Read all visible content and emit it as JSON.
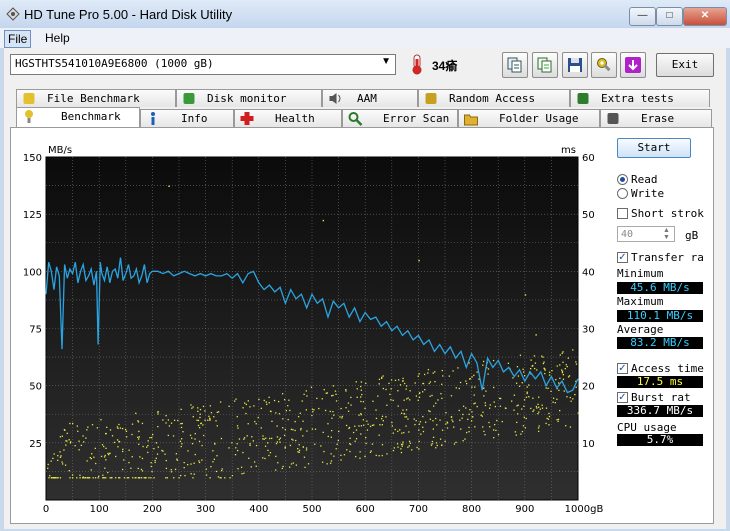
{
  "window": {
    "title": "HD Tune Pro 5.00 - Hard Disk Utility",
    "minimize": "—",
    "maximize": "□",
    "close": "✕"
  },
  "menu": {
    "file": "File",
    "help": "Help"
  },
  "toolbar": {
    "drive": "HGSTHTS541010A9E6800 (1000 gB)",
    "temperature": "34瘉",
    "exit_label": "Exit"
  },
  "tabs_top": [
    {
      "label": "File Benchmark",
      "icon": "file-benchmark-icon"
    },
    {
      "label": "Disk monitor",
      "icon": "disk-monitor-icon"
    },
    {
      "label": "AAM",
      "icon": "speaker-icon"
    },
    {
      "label": "Random Access",
      "icon": "random-access-icon"
    },
    {
      "label": "Extra tests",
      "icon": "extra-tests-icon"
    }
  ],
  "tabs_bottom": [
    {
      "label": "Benchmark",
      "icon": "benchmark-icon",
      "active": true
    },
    {
      "label": "Info",
      "icon": "info-icon"
    },
    {
      "label": "Health",
      "icon": "health-icon"
    },
    {
      "label": "Error Scan",
      "icon": "magnifier-icon"
    },
    {
      "label": "Folder Usage",
      "icon": "folder-icon"
    },
    {
      "label": "Erase",
      "icon": "trash-icon"
    }
  ],
  "panel": {
    "start": "Start",
    "read": "Read",
    "write": "Write",
    "short_stroke": "Short strok",
    "stroke_value": "40",
    "stroke_unit": "gB",
    "transfer_rate": "Transfer ra",
    "minimum_label": "Minimum",
    "minimum_value": "45.6 MB/s",
    "maximum_label": "Maximum",
    "maximum_value": "110.1 MB/s",
    "average_label": "Average",
    "average_value": "83.2 MB/s",
    "access_time": "Access time",
    "access_value": "17.5 ms",
    "burst_rate": "Burst rat",
    "burst_value": "336.7 MB/s",
    "cpu_label": "CPU usage",
    "cpu_value": "5.7%"
  },
  "chart_data": {
    "type": "line",
    "left_unit": "MB/s",
    "right_unit": "ms",
    "x_ticks": [
      "0",
      "100",
      "200",
      "300",
      "400",
      "500",
      "600",
      "700",
      "800",
      "900",
      "1000gB"
    ],
    "y_left_ticks": [
      "150",
      "125",
      "100",
      "75",
      "50",
      "25"
    ],
    "y_right_ticks": [
      "60",
      "50",
      "40",
      "30",
      "20",
      "10"
    ],
    "x_range": [
      0,
      1000
    ],
    "y_left_range": [
      0,
      150
    ],
    "y_right_range": [
      0,
      60
    ],
    "grid": true,
    "colors": {
      "transfer": "#2aa4e0",
      "access": "#e8e84a",
      "background_top": "#0b0b0b",
      "background_bottom": "#2f2f2f",
      "grid": "#6e6e6e"
    },
    "transfer_series": [
      [
        0,
        90
      ],
      [
        5,
        104
      ],
      [
        10,
        100
      ],
      [
        15,
        92
      ],
      [
        20,
        102
      ],
      [
        25,
        98
      ],
      [
        30,
        66
      ],
      [
        35,
        103
      ],
      [
        40,
        97
      ],
      [
        45,
        101
      ],
      [
        50,
        99
      ],
      [
        55,
        104
      ],
      [
        60,
        95
      ],
      [
        65,
        100
      ],
      [
        70,
        103
      ],
      [
        75,
        96
      ],
      [
        80,
        98
      ],
      [
        85,
        101
      ],
      [
        90,
        94
      ],
      [
        95,
        100
      ],
      [
        98,
        68
      ],
      [
        102,
        104
      ],
      [
        105,
        99
      ],
      [
        110,
        96
      ],
      [
        115,
        102
      ],
      [
        120,
        95
      ],
      [
        125,
        100
      ],
      [
        130,
        101
      ],
      [
        135,
        97
      ],
      [
        140,
        106
      ],
      [
        145,
        96
      ],
      [
        150,
        99
      ],
      [
        155,
        103
      ],
      [
        160,
        97
      ],
      [
        165,
        98
      ],
      [
        170,
        101
      ],
      [
        175,
        95
      ],
      [
        180,
        98
      ],
      [
        185,
        103
      ],
      [
        190,
        95
      ],
      [
        195,
        99
      ],
      [
        200,
        100
      ],
      [
        210,
        100
      ],
      [
        220,
        99
      ],
      [
        230,
        100
      ],
      [
        240,
        98
      ],
      [
        250,
        99
      ],
      [
        260,
        100
      ],
      [
        270,
        99
      ],
      [
        280,
        98
      ],
      [
        290,
        99
      ],
      [
        300,
        98
      ],
      [
        310,
        99
      ],
      [
        320,
        98
      ],
      [
        330,
        98
      ],
      [
        340,
        99
      ],
      [
        350,
        97
      ],
      [
        360,
        99
      ],
      [
        370,
        95
      ],
      [
        380,
        99
      ],
      [
        390,
        100
      ],
      [
        400,
        95
      ],
      [
        410,
        92
      ],
      [
        420,
        94
      ],
      [
        430,
        91
      ],
      [
        440,
        93
      ],
      [
        450,
        86
      ],
      [
        460,
        92
      ],
      [
        470,
        88
      ],
      [
        480,
        90
      ],
      [
        490,
        84
      ],
      [
        500,
        90
      ],
      [
        510,
        86
      ],
      [
        520,
        88
      ],
      [
        530,
        80
      ],
      [
        540,
        87
      ],
      [
        550,
        84
      ],
      [
        560,
        86
      ],
      [
        570,
        80
      ],
      [
        580,
        84
      ],
      [
        590,
        78
      ],
      [
        600,
        82
      ],
      [
        610,
        79
      ],
      [
        620,
        80
      ],
      [
        630,
        76
      ],
      [
        640,
        78
      ],
      [
        650,
        74
      ],
      [
        660,
        76
      ],
      [
        670,
        72
      ],
      [
        680,
        74
      ],
      [
        690,
        70
      ],
      [
        700,
        72
      ],
      [
        710,
        68
      ],
      [
        720,
        70
      ],
      [
        730,
        65
      ],
      [
        740,
        68
      ],
      [
        750,
        64
      ],
      [
        760,
        67
      ],
      [
        770,
        62
      ],
      [
        780,
        65
      ],
      [
        790,
        58
      ],
      [
        800,
        64
      ],
      [
        810,
        60
      ],
      [
        820,
        48
      ],
      [
        830,
        62
      ],
      [
        840,
        58
      ],
      [
        850,
        61
      ],
      [
        860,
        56
      ],
      [
        870,
        58
      ],
      [
        880,
        54
      ],
      [
        890,
        57
      ],
      [
        900,
        52
      ],
      [
        910,
        56
      ],
      [
        920,
        53
      ],
      [
        930,
        56
      ],
      [
        940,
        50
      ],
      [
        950,
        54
      ],
      [
        960,
        49
      ],
      [
        970,
        52
      ],
      [
        980,
        47
      ],
      [
        990,
        48
      ],
      [
        1000,
        53
      ]
    ],
    "access_scatter_range": {
      "x": [
        0,
        1000
      ],
      "ms_min": 4,
      "ms_max": 30,
      "count": 900
    }
  }
}
